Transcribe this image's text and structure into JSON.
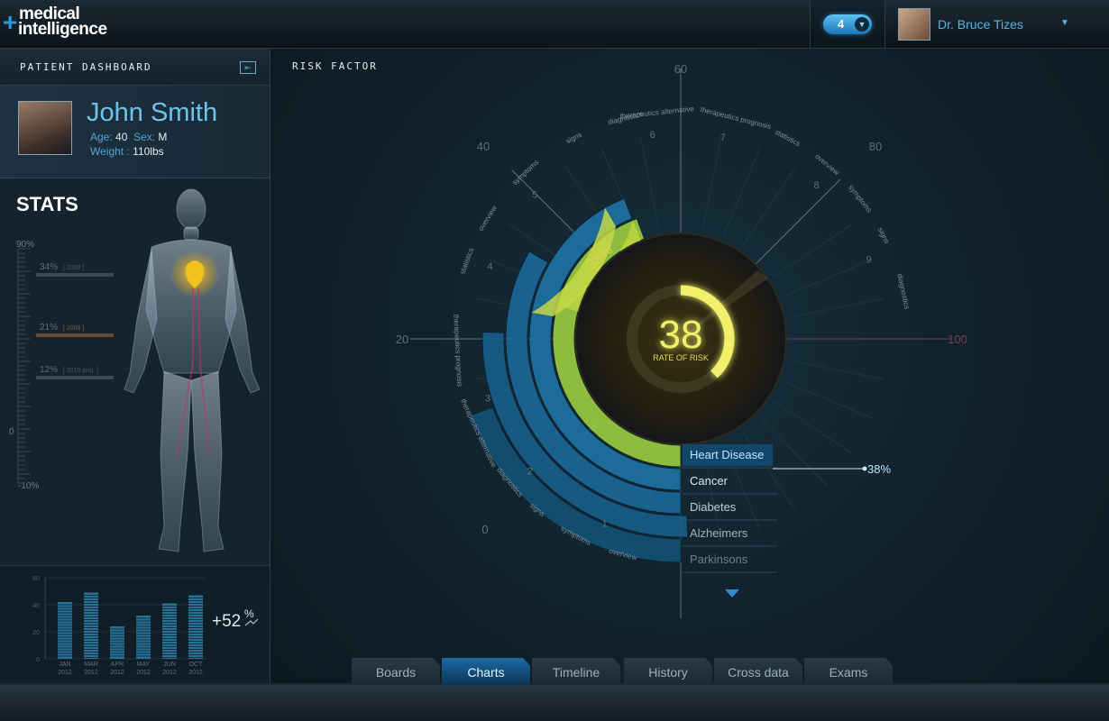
{
  "app": {
    "logo_line1": "medical",
    "logo_line2": "intelligence"
  },
  "header": {
    "notification_count": "4",
    "user_name": "Dr. Bruce Tizes"
  },
  "left_panel": {
    "title": "PATIENT DASHBOARD",
    "patient": {
      "name": "John Smith",
      "age_label": "Age:",
      "age": "40",
      "sex_label": "Sex:",
      "sex": "M",
      "weight_label": "Weight :",
      "weight": "110lbs"
    },
    "stats_title": "STATS",
    "scale": {
      "top": "90%",
      "zero": "0",
      "bottom": "-10%",
      "markers": [
        {
          "value": "34%",
          "tag": "[ 2008 ]"
        },
        {
          "value": "21%",
          "tag": "[ 2008 ]"
        },
        {
          "value": "12%",
          "tag": "[ 2010 proj. ]"
        }
      ]
    },
    "mini_chart": {
      "y_ticks": [
        "60",
        "40",
        "20",
        "0"
      ],
      "change": "+52",
      "change_unit": "%"
    }
  },
  "risk": {
    "title": "RISK FACTOR",
    "score": "38",
    "score_label": "RATE OF RISK",
    "arc_label": "38%",
    "axis_labels": [
      "0",
      "20",
      "40",
      "60",
      "80",
      "100"
    ],
    "ring_labels_left": [
      "overview",
      "symptoms",
      "signs",
      "diagnostics",
      "therapeutics alternative",
      "therapeutics prognosis",
      "statistics",
      "overview",
      "symptoms",
      "signs",
      "diagnostics",
      "therapeutics alternative"
    ],
    "ring_labels_right": [
      "therapeutics prognosis",
      "statistics",
      "overview",
      "symptoms",
      "signs",
      "diagnostics"
    ],
    "sector_numbers": [
      "1",
      "2",
      "3",
      "4",
      "5",
      "6",
      "7",
      "8",
      "9"
    ],
    "diseases": [
      {
        "name": "Heart Disease",
        "value": "38%"
      },
      {
        "name": "Cancer"
      },
      {
        "name": "Diabetes"
      },
      {
        "name": "Alzheimers"
      },
      {
        "name": "Parkinsons"
      }
    ]
  },
  "tabs": [
    "Boards",
    "Charts",
    "Timeline",
    "History",
    "Cross data",
    "Exams"
  ],
  "chart_data": {
    "type": "bar",
    "categories": [
      "JAN 2012",
      "MAR 2012",
      "APR 2012",
      "MAY 2012",
      "JUN 2012",
      "OCT 2012"
    ],
    "values": [
      42,
      49,
      24,
      32,
      41,
      47
    ],
    "ylim": [
      0,
      60
    ]
  }
}
